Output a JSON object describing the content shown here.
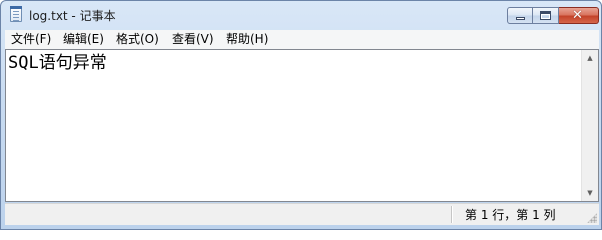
{
  "window": {
    "title": "log.txt - 记事本",
    "close_glyph": "✕"
  },
  "menu": {
    "items": [
      {
        "label": "文件(F)"
      },
      {
        "label": "编辑(E)"
      },
      {
        "label": "格式(O)"
      },
      {
        "label": "查看(V)"
      },
      {
        "label": "帮助(H)"
      }
    ]
  },
  "editor": {
    "content": "SQL语句异常"
  },
  "scrollbar": {
    "up_arrow": "▲",
    "down_arrow": "▼"
  },
  "status": {
    "position": "第 1 行，第 1 列"
  },
  "icons": {
    "app": "notepad-icon",
    "minimize": "minimize-icon",
    "maximize": "maximize-icon",
    "close": "close-icon"
  },
  "colors": {
    "title_bar": "#c8dbf1",
    "close_button": "#c4432a",
    "menu_bar": "#f5f6f7",
    "status_bar": "#f0f0f0"
  }
}
